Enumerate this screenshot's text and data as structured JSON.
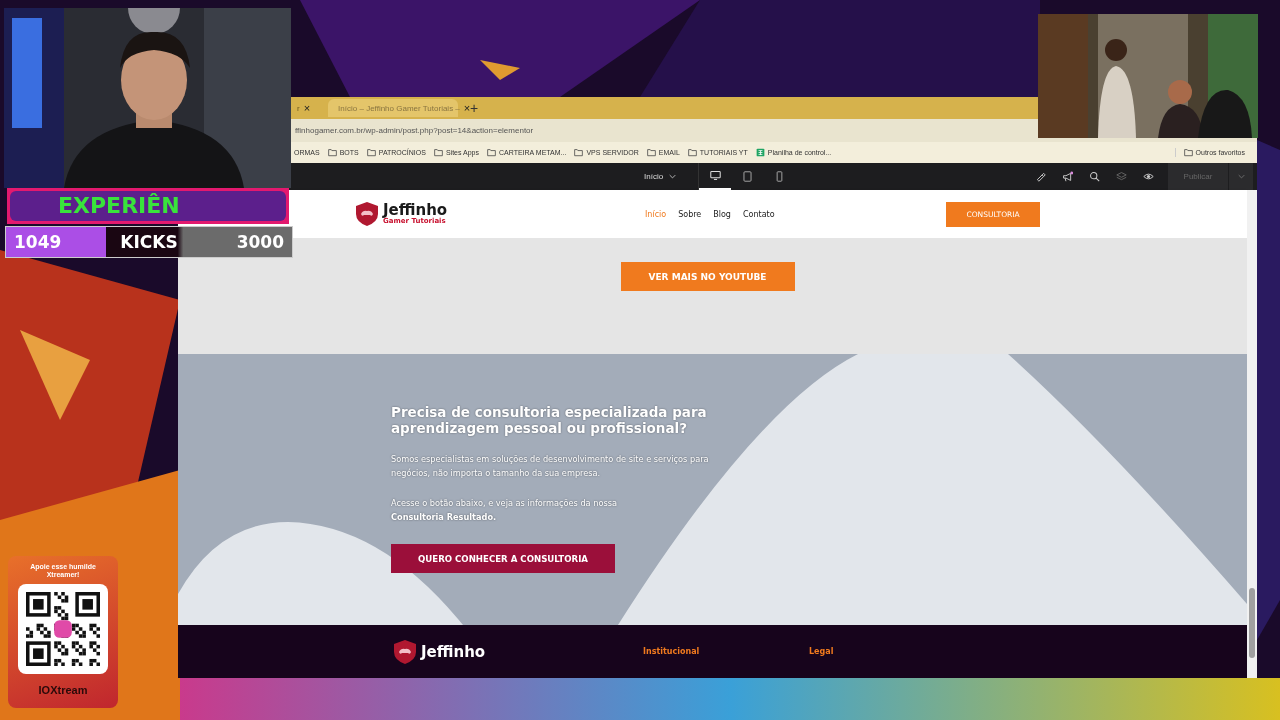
{
  "browser": {
    "tabs": [
      {
        "label": "r",
        "selected": false,
        "close": "×"
      },
      {
        "label": "Início – Jeffinho Gamer Tutoriais –",
        "selected": true,
        "close": "×"
      }
    ],
    "new_tab": "+",
    "address": "ffinhogamer.com.br/wp-admin/post.php?post=14&action=elementor",
    "bookmarks": [
      {
        "label": "ORMAS",
        "kind": "text"
      },
      {
        "label": "BOTS",
        "kind": "folder"
      },
      {
        "label": "PATROCÍNIOS",
        "kind": "folder"
      },
      {
        "label": "Sites Apps",
        "kind": "folder"
      },
      {
        "label": "CARTEIRA METAM...",
        "kind": "folder"
      },
      {
        "label": "VPS SERVIDOR",
        "kind": "folder"
      },
      {
        "label": "EMAIL",
        "kind": "folder"
      },
      {
        "label": "TUTORIAIS YT",
        "kind": "folder"
      },
      {
        "label": "Planilha de control...",
        "kind": "sheet"
      }
    ],
    "other_bookmarks": "Outros favoritos"
  },
  "editor_bar": {
    "page": "Início",
    "devices": [
      {
        "kind": "desktop",
        "selected": true
      },
      {
        "kind": "tablet",
        "selected": false
      },
      {
        "kind": "mobile",
        "selected": false
      }
    ],
    "publish": {
      "label": "Publicar",
      "disabled": true
    }
  },
  "site": {
    "logo": {
      "name": "Jeffinho",
      "tagline": "Gamer Tutoriais"
    },
    "nav": [
      {
        "label": "Início",
        "selected": true
      },
      {
        "label": "Sobre",
        "selected": false
      },
      {
        "label": "Blog",
        "selected": false
      },
      {
        "label": "Contato",
        "selected": false
      }
    ],
    "cta": "CONSULTORIA",
    "youtube_button": "VER MAIS NO YOUTUBE",
    "consulting": {
      "heading": "Precisa de consultoria especializada para aprendizagem pessoal ou profissional?",
      "paragraphs": [
        "Somos especialistas em soluções de desenvolvimento de site e serviços para negócios, não importa o tamanho da sua empresa.",
        "Acesse o botão abaixo, e veja as informações da nossa **Consultoria Resultado.**"
      ],
      "button": "QUERO CONHECER A CONSULTORIA"
    },
    "footer": {
      "logo": "Jeffinho",
      "columns": [
        "Institucional",
        "Legal"
      ]
    }
  },
  "stream_overlay": {
    "goal_title": "EXPERIÊN",
    "goal": {
      "current": "1049",
      "label": "KICKS",
      "target": "3000",
      "level": 0.35
    },
    "donation": {
      "caption": "Apoie esse humilde Xtreamer!",
      "brand": "IOXtream"
    }
  }
}
